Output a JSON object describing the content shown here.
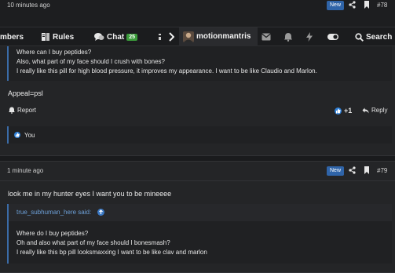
{
  "post1": {
    "timestamp": "10 minutes ago",
    "badge": "New",
    "number": "#78",
    "quote_lines": [
      "Where can I buy peptides?",
      "Also, what part of my face should I crush with bones?",
      "I really like this pill for high blood pressure, it improves my appearance. I want to be like Claudio and Marlon."
    ],
    "body": "Appeal=psl",
    "report_label": "Report",
    "reaction_count": "+1",
    "reply_label": "Reply",
    "likes_label": "You"
  },
  "navbar": {
    "members_label": "mbers",
    "rules_label": "Rules",
    "chat_label": "Chat",
    "chat_count": "25",
    "username": "motionmantris",
    "search_label": "Search"
  },
  "post2": {
    "timestamp": "1 minute ago",
    "badge": "New",
    "number": "#79",
    "body": "look me in my hunter eyes I want you to be mineeee",
    "quote_author": "true_subhuman_here said:",
    "quote_lines": [
      "Where do I buy peptides?",
      "Oh and also what part of my face should I bonesmash?",
      "I really like this bp pill looksmaxxing I want to be like clav and marlon"
    ]
  },
  "colors": {
    "accent": "#2f64a8",
    "chat_badge": "#3b9c3b",
    "link": "#6da0d8",
    "background": "#1d1e20"
  }
}
